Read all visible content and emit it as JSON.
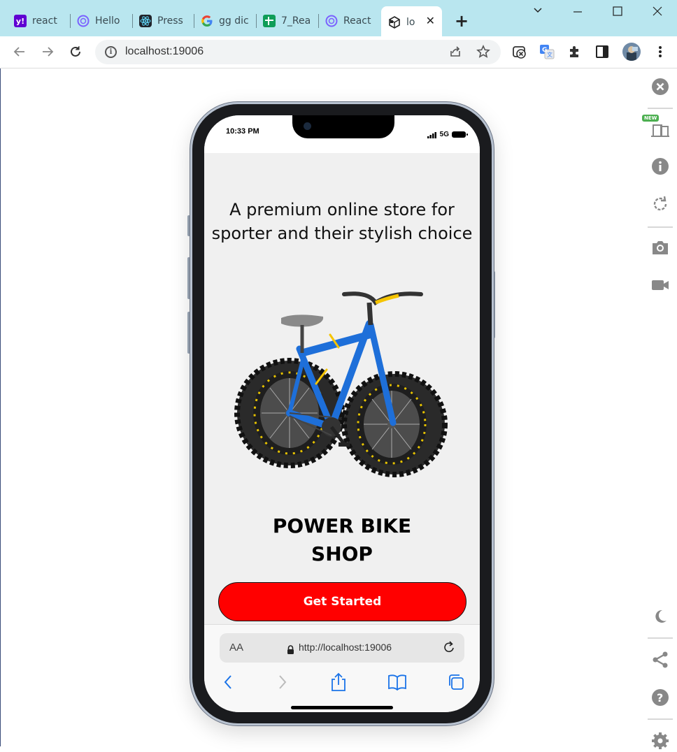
{
  "browser": {
    "tabs": [
      {
        "label": "react",
        "icon": "yahoo-icon",
        "color": "#6001d2"
      },
      {
        "label": "Hello",
        "icon": "figma-globe-icon",
        "color": "#7b61ff"
      },
      {
        "label": "Press",
        "icon": "react-icon",
        "color": "#61dafb"
      },
      {
        "label": "gg dic",
        "icon": "google-icon",
        "color": "#4285f4"
      },
      {
        "label": "7_Rea",
        "icon": "sheets-icon",
        "color": "#0f9d58"
      },
      {
        "label": "React",
        "icon": "figma-globe-icon",
        "color": "#7b61ff"
      },
      {
        "label": "lo",
        "icon": "responsive-cube-icon",
        "color": "#222222",
        "active": true
      }
    ],
    "new_tab": "+",
    "address": "localhost:19006"
  },
  "phone": {
    "status": {
      "time": "10:33 PM",
      "network": "5G"
    },
    "page": {
      "tagline": "A premium online store for sporter and their stylish choice",
      "title_line1": "POWER BIKE",
      "title_line2": "SHOP",
      "cta": "Get Started"
    },
    "safari": {
      "text_size": "AA",
      "url": "http://localhost:19006"
    }
  },
  "side_panel": {
    "new_badge": "NEW"
  },
  "colors": {
    "tabstrip": "#b9e6ef",
    "cta": "#ff0000",
    "safari_blue": "#1a73e8"
  }
}
